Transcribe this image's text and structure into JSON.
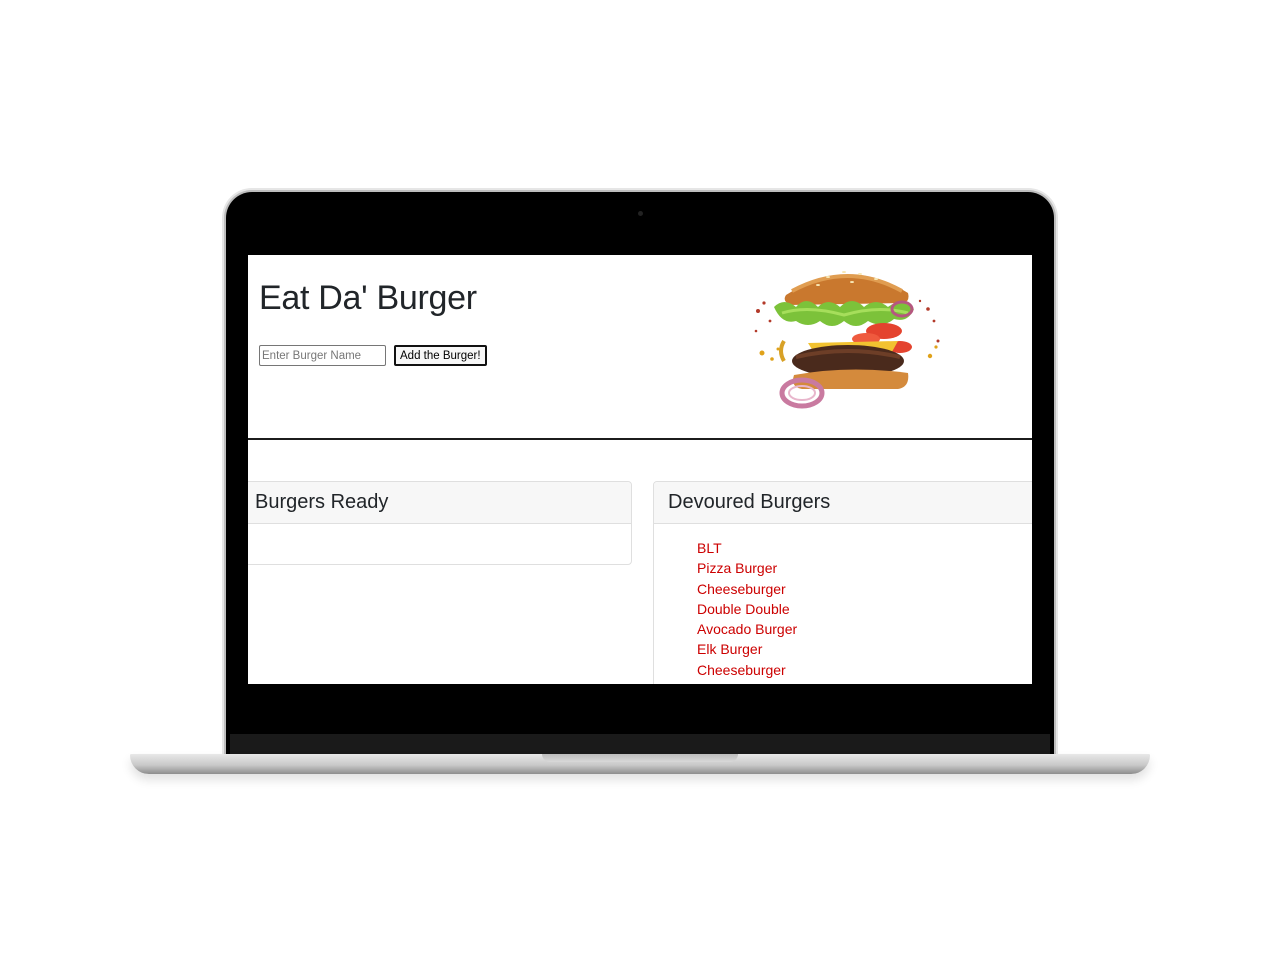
{
  "header": {
    "title": "Eat Da' Burger"
  },
  "form": {
    "input_placeholder": "Enter Burger Name",
    "input_value": "",
    "submit_label": "Add the Burger!"
  },
  "ready_panel": {
    "title": "Burgers Ready",
    "items": []
  },
  "devoured_panel": {
    "title": "Devoured Burgers",
    "items": [
      {
        "label": "BLT"
      },
      {
        "label": "Pizza Burger"
      },
      {
        "label": "Cheeseburger"
      },
      {
        "label": "Double Double"
      },
      {
        "label": "Avocado Burger"
      },
      {
        "label": "Elk Burger"
      },
      {
        "label": "Cheeseburger"
      }
    ]
  },
  "colors": {
    "link": "#cc0000",
    "header_bg": "#f7f7f7",
    "divider": "#1c1c1c"
  }
}
